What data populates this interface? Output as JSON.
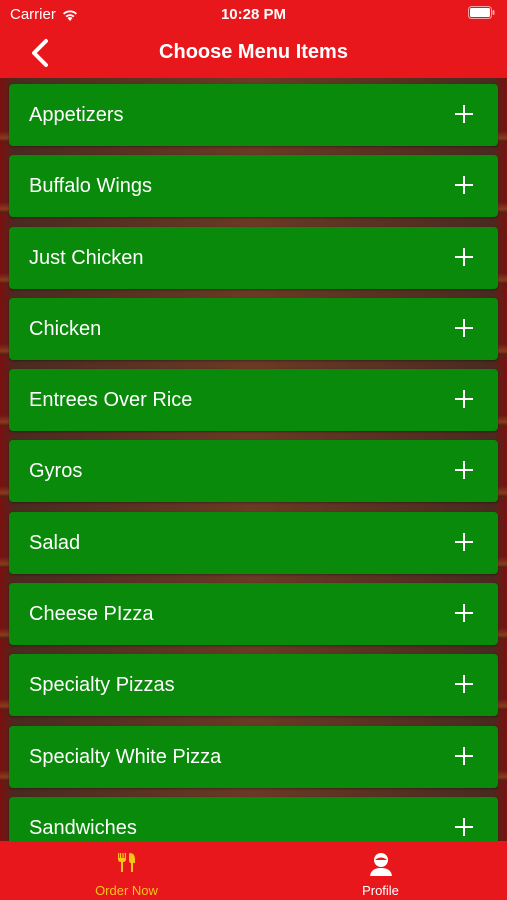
{
  "status_bar": {
    "carrier": "Carrier",
    "time": "10:28 PM"
  },
  "nav": {
    "title": "Choose Menu Items"
  },
  "menu": {
    "items": [
      {
        "label": "Appetizers"
      },
      {
        "label": "Buffalo Wings"
      },
      {
        "label": "Just Chicken"
      },
      {
        "label": "Chicken"
      },
      {
        "label": "Entrees Over Rice"
      },
      {
        "label": "Gyros"
      },
      {
        "label": "Salad"
      },
      {
        "label": "Cheese PIzza"
      },
      {
        "label": "Specialty Pizzas"
      },
      {
        "label": "Specialty White Pizza"
      },
      {
        "label": "Sandwiches"
      }
    ]
  },
  "tabs": [
    {
      "label": "Order Now",
      "icon": "utensils-icon",
      "active": true
    },
    {
      "label": "Profile",
      "icon": "profile-icon",
      "active": false
    }
  ],
  "colors": {
    "bar_red": "#e8171c",
    "item_green": "#0a8a0a",
    "active_tab": "#f5c518"
  }
}
